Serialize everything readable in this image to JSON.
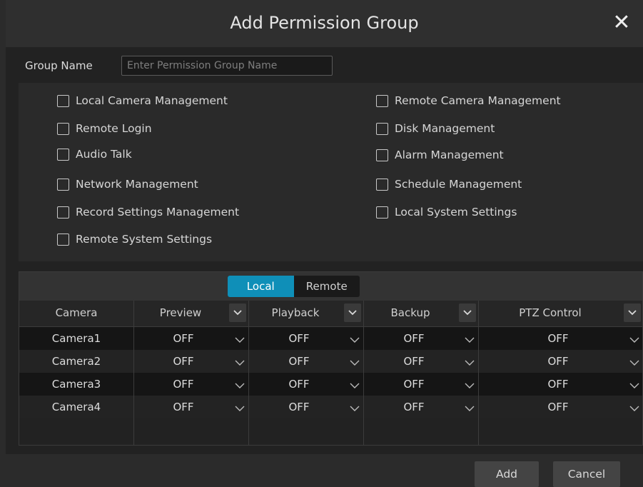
{
  "dialog": {
    "title": "Add Permission Group",
    "close_icon": "close-icon"
  },
  "group_name": {
    "label": "Group Name",
    "placeholder": "Enter Permission Group Name",
    "value": ""
  },
  "permissions": {
    "left": [
      {
        "label": "Local Camera Management",
        "checked": false
      },
      {
        "label": "Remote Login",
        "checked": false
      },
      {
        "label": "Audio Talk",
        "checked": false
      },
      {
        "label": "Network Management",
        "checked": false
      },
      {
        "label": "Record Settings Management",
        "checked": false
      },
      {
        "label": "Remote System Settings",
        "checked": false
      }
    ],
    "right": [
      {
        "label": "Remote Camera Management",
        "checked": false
      },
      {
        "label": "Disk Management",
        "checked": false
      },
      {
        "label": "Alarm Management",
        "checked": false
      },
      {
        "label": "Schedule Management",
        "checked": false
      },
      {
        "label": "Local System Settings",
        "checked": false
      }
    ]
  },
  "tabs": {
    "items": [
      "Local",
      "Remote"
    ],
    "active": "Local"
  },
  "table": {
    "columns": [
      "Camera",
      "Preview",
      "Playback",
      "Backup",
      "PTZ Control"
    ],
    "rows": [
      {
        "camera": "Camera1",
        "preview": "OFF",
        "playback": "OFF",
        "backup": "OFF",
        "ptz": "OFF"
      },
      {
        "camera": "Camera2",
        "preview": "OFF",
        "playback": "OFF",
        "backup": "OFF",
        "ptz": "OFF"
      },
      {
        "camera": "Camera3",
        "preview": "OFF",
        "playback": "OFF",
        "backup": "OFF",
        "ptz": "OFF"
      },
      {
        "camera": "Camera4",
        "preview": "OFF",
        "playback": "OFF",
        "backup": "OFF",
        "ptz": "OFF"
      }
    ]
  },
  "buttons": {
    "add": "Add",
    "cancel": "Cancel"
  },
  "colors": {
    "accent_tab": "#0f8fb8",
    "background": "#2b2b2b"
  }
}
